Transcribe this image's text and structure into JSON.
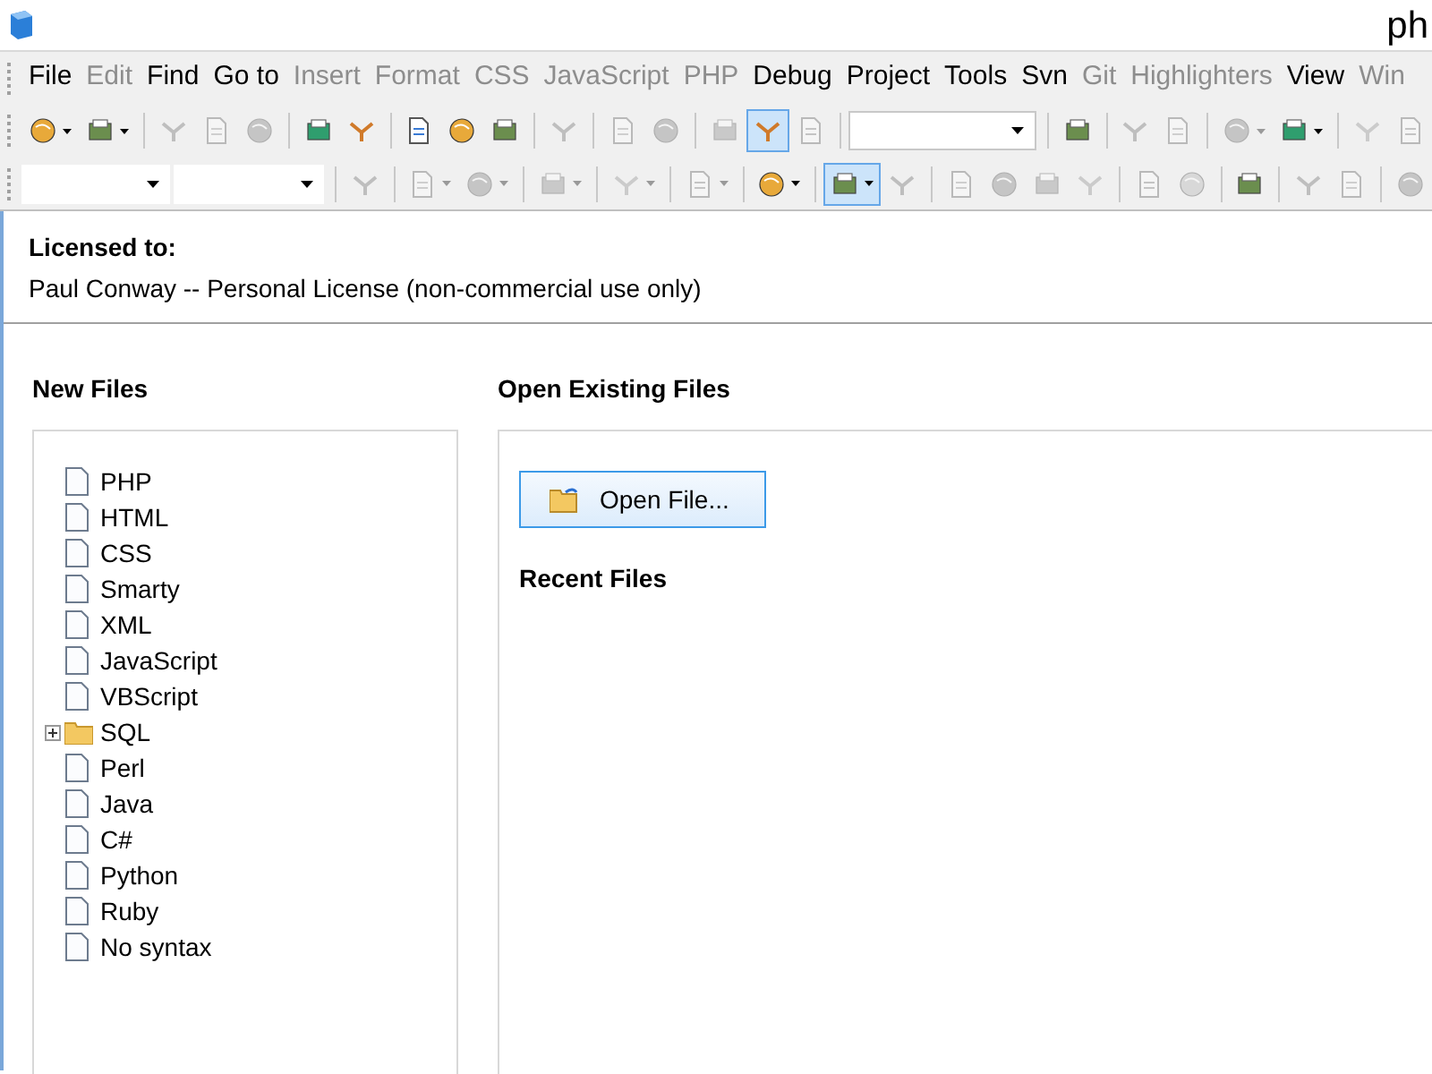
{
  "window": {
    "title": "ph"
  },
  "menu": [
    {
      "label": "File",
      "disabled": false
    },
    {
      "label": "Edit",
      "disabled": true
    },
    {
      "label": "Find",
      "disabled": false
    },
    {
      "label": "Go to",
      "disabled": false
    },
    {
      "label": "Insert",
      "disabled": true
    },
    {
      "label": "Format",
      "disabled": true
    },
    {
      "label": "CSS",
      "disabled": true
    },
    {
      "label": "JavaScript",
      "disabled": true
    },
    {
      "label": "PHP",
      "disabled": true
    },
    {
      "label": "Debug",
      "disabled": false
    },
    {
      "label": "Project",
      "disabled": false
    },
    {
      "label": "Tools",
      "disabled": false
    },
    {
      "label": "Svn",
      "disabled": false
    },
    {
      "label": "Git",
      "disabled": true
    },
    {
      "label": "Highlighters",
      "disabled": true
    },
    {
      "label": "View",
      "disabled": false
    },
    {
      "label": "Win",
      "disabled": true
    }
  ],
  "toolbars": [
    {
      "groups": [
        [
          {
            "kind": "button",
            "disabled": false,
            "dropdown": true,
            "pressed": false
          },
          {
            "kind": "button",
            "disabled": false,
            "dropdown": true,
            "pressed": false
          }
        ],
        [
          {
            "kind": "button",
            "disabled": true,
            "dropdown": false,
            "pressed": false
          },
          {
            "kind": "button",
            "disabled": true,
            "dropdown": false,
            "pressed": false
          },
          {
            "kind": "button",
            "disabled": true,
            "dropdown": false,
            "pressed": false
          }
        ],
        [
          {
            "kind": "button",
            "disabled": false,
            "dropdown": false,
            "pressed": false
          },
          {
            "kind": "button",
            "disabled": false,
            "dropdown": false,
            "pressed": false
          }
        ],
        [
          {
            "kind": "button",
            "disabled": false,
            "dropdown": false,
            "pressed": false
          },
          {
            "kind": "button",
            "disabled": false,
            "dropdown": false,
            "pressed": false
          },
          {
            "kind": "button",
            "disabled": false,
            "dropdown": false,
            "pressed": false
          }
        ],
        [
          {
            "kind": "button",
            "disabled": true,
            "dropdown": false,
            "pressed": false
          }
        ],
        [
          {
            "kind": "button",
            "disabled": true,
            "dropdown": false,
            "pressed": false
          },
          {
            "kind": "button",
            "disabled": true,
            "dropdown": false,
            "pressed": false
          }
        ],
        [
          {
            "kind": "button",
            "disabled": true,
            "dropdown": false,
            "pressed": false
          },
          {
            "kind": "button",
            "disabled": false,
            "dropdown": false,
            "pressed": true
          },
          {
            "kind": "button",
            "disabled": true,
            "dropdown": false,
            "pressed": false
          }
        ],
        [
          {
            "kind": "combo",
            "disabled": false,
            "dropdown": true,
            "pressed": false
          }
        ],
        [
          {
            "kind": "button",
            "disabled": false,
            "dropdown": false,
            "pressed": false
          }
        ],
        [
          {
            "kind": "button",
            "disabled": true,
            "dropdown": false,
            "pressed": false
          },
          {
            "kind": "button",
            "disabled": true,
            "dropdown": false,
            "pressed": false
          }
        ],
        [
          {
            "kind": "button",
            "disabled": true,
            "dropdown": true,
            "pressed": false
          },
          {
            "kind": "button",
            "disabled": false,
            "dropdown": true,
            "pressed": false
          }
        ],
        [
          {
            "kind": "button",
            "disabled": true,
            "dropdown": false,
            "pressed": false
          },
          {
            "kind": "button",
            "disabled": true,
            "dropdown": false,
            "pressed": false
          }
        ]
      ]
    },
    {
      "groups": [
        [
          {
            "kind": "combo",
            "disabled": false,
            "dropdown": true,
            "pressed": false
          },
          {
            "kind": "combo",
            "disabled": false,
            "dropdown": true,
            "pressed": false
          }
        ],
        [
          {
            "kind": "button",
            "disabled": true,
            "dropdown": false,
            "pressed": false
          }
        ],
        [
          {
            "kind": "button",
            "disabled": true,
            "dropdown": true,
            "pressed": false
          },
          {
            "kind": "button",
            "disabled": true,
            "dropdown": true,
            "pressed": false
          }
        ],
        [
          {
            "kind": "button",
            "disabled": true,
            "dropdown": true,
            "pressed": false
          }
        ],
        [
          {
            "kind": "button",
            "disabled": true,
            "dropdown": true,
            "pressed": false
          }
        ],
        [
          {
            "kind": "button",
            "disabled": true,
            "dropdown": true,
            "pressed": false
          }
        ],
        [
          {
            "kind": "button",
            "disabled": false,
            "dropdown": true,
            "pressed": false
          }
        ],
        [
          {
            "kind": "button",
            "disabled": false,
            "dropdown": true,
            "pressed": true
          },
          {
            "kind": "button",
            "disabled": true,
            "dropdown": false,
            "pressed": false
          }
        ],
        [
          {
            "kind": "button",
            "disabled": true,
            "dropdown": false,
            "pressed": false
          },
          {
            "kind": "button",
            "disabled": true,
            "dropdown": false,
            "pressed": false
          },
          {
            "kind": "button",
            "disabled": true,
            "dropdown": false,
            "pressed": false
          },
          {
            "kind": "button",
            "disabled": true,
            "dropdown": false,
            "pressed": false
          }
        ],
        [
          {
            "kind": "button",
            "disabled": true,
            "dropdown": false,
            "pressed": false
          },
          {
            "kind": "button",
            "disabled": true,
            "dropdown": false,
            "pressed": false
          }
        ],
        [
          {
            "kind": "button",
            "disabled": false,
            "dropdown": false,
            "pressed": false
          }
        ],
        [
          {
            "kind": "button",
            "disabled": true,
            "dropdown": false,
            "pressed": false
          },
          {
            "kind": "button",
            "disabled": true,
            "dropdown": false,
            "pressed": false
          }
        ],
        [
          {
            "kind": "button",
            "disabled": true,
            "dropdown": false,
            "pressed": false
          }
        ]
      ]
    }
  ],
  "license": {
    "heading": "Licensed to:",
    "text": "Paul Conway -- Personal License (non-commercial use only)"
  },
  "new_files": {
    "heading": "New Files",
    "items": [
      {
        "label": "PHP",
        "kind": "file"
      },
      {
        "label": "HTML",
        "kind": "file"
      },
      {
        "label": "CSS",
        "kind": "file"
      },
      {
        "label": "Smarty",
        "kind": "file"
      },
      {
        "label": "XML",
        "kind": "file"
      },
      {
        "label": "JavaScript",
        "kind": "file"
      },
      {
        "label": "VBScript",
        "kind": "file"
      },
      {
        "label": "SQL",
        "kind": "folder",
        "expanded": false
      },
      {
        "label": "Perl",
        "kind": "file"
      },
      {
        "label": "Java",
        "kind": "file"
      },
      {
        "label": "C#",
        "kind": "file"
      },
      {
        "label": "Python",
        "kind": "file"
      },
      {
        "label": "Ruby",
        "kind": "file"
      },
      {
        "label": "No syntax",
        "kind": "file"
      }
    ]
  },
  "open_existing": {
    "heading": "Open Existing Files",
    "button": "Open File...",
    "recent_heading": "Recent Files"
  }
}
